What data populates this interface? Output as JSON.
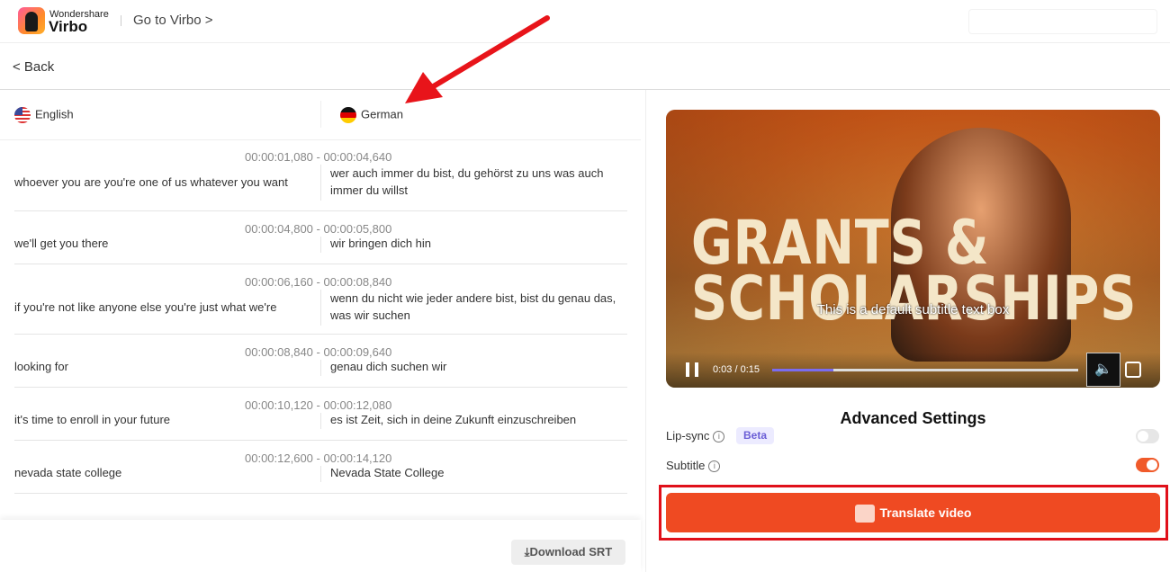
{
  "header": {
    "brand_top": "Wondershare",
    "brand_bottom": "Virbo",
    "goto": "Go to Virbo >"
  },
  "nav": {
    "back": "< Back"
  },
  "languages": {
    "source": "English",
    "target": "German"
  },
  "rows": [
    {
      "time": "00:00:01,080 - 00:00:04,640",
      "source": "whoever you are you're one of us whatever you want",
      "target": "wer auch immer du bist, du gehörst zu uns was auch immer du willst"
    },
    {
      "time": "00:00:04,800 - 00:00:05,800",
      "source": "we'll get you there",
      "target": "wir bringen dich hin"
    },
    {
      "time": "00:00:06,160 - 00:00:08,840",
      "source": "if you're not like anyone else you're just what we're",
      "target": "wenn du nicht wie jeder andere bist, bist du genau das, was wir suchen"
    },
    {
      "time": "00:00:08,840 - 00:00:09,640",
      "source": "looking for",
      "target": "genau dich suchen wir"
    },
    {
      "time": "00:00:10,120 - 00:00:12,080",
      "source": "it's time to enroll in your future",
      "target": "es ist Zeit, sich in deine Zukunft einzuschreiben"
    },
    {
      "time": "00:00:12,600 - 00:00:14,120",
      "source": "nevada state college",
      "target": "Nevada State College"
    }
  ],
  "download": "Download SRT",
  "video": {
    "overlay_title": "GRANTS & SCHOLARSHIPS",
    "subtitle": "This is a default subtitle text box",
    "time": "0:03 / 0:15",
    "progress": 0.2
  },
  "settings": {
    "title": "Advanced Settings",
    "lipsync": "Lip-sync",
    "beta": "Beta",
    "lipsync_on": false,
    "subtitle": "Subtitle",
    "subtitle_on": true
  },
  "translate": "Translate video",
  "colors": {
    "accent": "#ef4a22",
    "highlight": "#e0101a",
    "progress": "#7a6cf0"
  }
}
